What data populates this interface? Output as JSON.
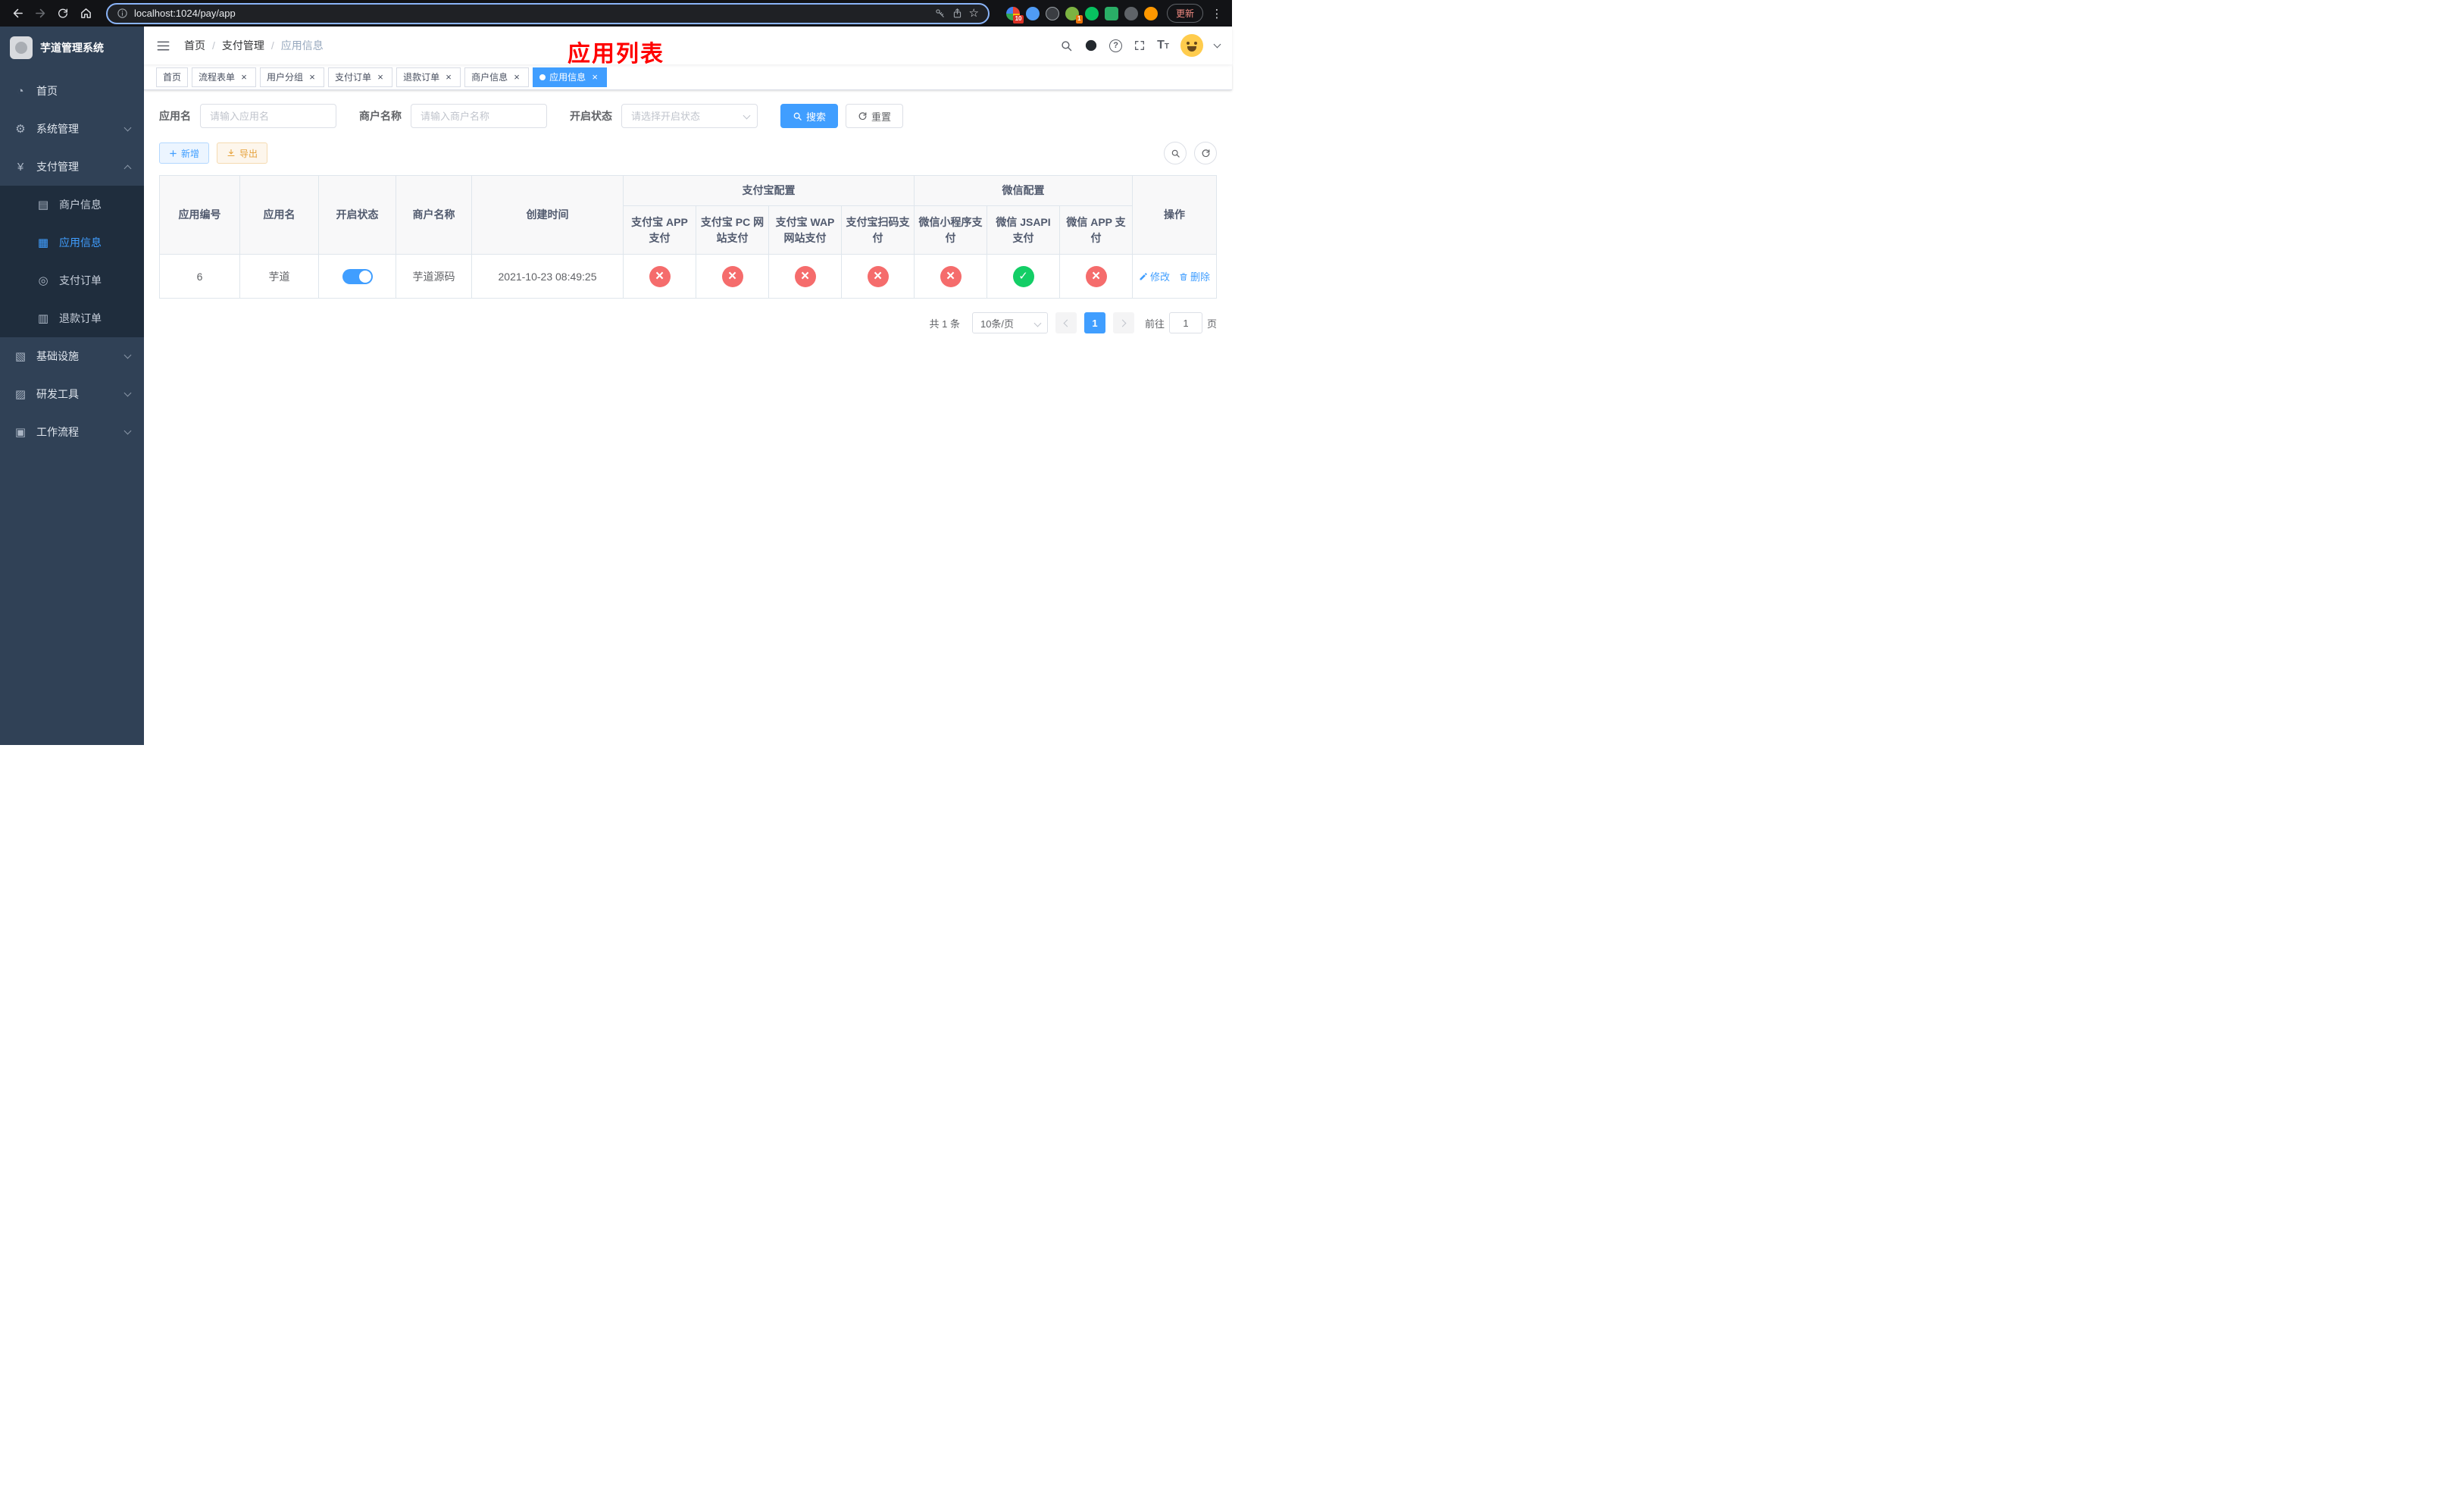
{
  "colors": {
    "accent": "#409EFF",
    "danger": "#F56C6C",
    "success": "#13CE66",
    "warning": "#E6A23C",
    "title_red": "#FF0000",
    "sidebar_bg": "#304156",
    "submenu_bg": "#1F2D3D"
  },
  "browser": {
    "url": "localhost:1024/pay/app",
    "update_label": "更新",
    "ext_badge_1": "10",
    "ext_badge_2": "1"
  },
  "sidebar": {
    "logo_title": "芋道管理系统",
    "home": "首页",
    "system": "系统管理",
    "payment": "支付管理",
    "merchant_info": "商户信息",
    "app_info": "应用信息",
    "pay_order": "支付订单",
    "refund_order": "退款订单",
    "infra": "基础设施",
    "dev_tools": "研发工具",
    "workflow": "工作流程"
  },
  "header": {
    "breadcrumb": [
      "首页",
      "支付管理",
      "应用信息"
    ],
    "page_title": "应用列表"
  },
  "tabs": [
    {
      "label": "首页"
    },
    {
      "label": "流程表单"
    },
    {
      "label": "用户分组"
    },
    {
      "label": "支付订单"
    },
    {
      "label": "退款订单"
    },
    {
      "label": "商户信息"
    },
    {
      "label": "应用信息"
    }
  ],
  "filters": {
    "app_name_label": "应用名",
    "app_name_placeholder": "请输入应用名",
    "merchant_label": "商户名称",
    "merchant_placeholder": "请输入商户名称",
    "status_label": "开启状态",
    "status_placeholder": "请选择开启状态",
    "search_label": "搜索",
    "reset_label": "重置"
  },
  "toolbar": {
    "add_label": "新增",
    "export_label": "导出"
  },
  "table": {
    "headers": {
      "app_id": "应用编号",
      "app_name": "应用名",
      "status": "开启状态",
      "merchant": "商户名称",
      "created": "创建时间",
      "alipay_group": "支付宝配置",
      "wechat_group": "微信配置",
      "alipay_app": "支付宝 APP 支付",
      "alipay_pc": "支付宝 PC 网站支付",
      "alipay_wap": "支付宝 WAP 网站支付",
      "alipay_qr": "支付宝扫码支付",
      "wx_mini": "微信小程序支付",
      "wx_jsapi": "微信 JSAPI 支付",
      "wx_app": "微信 APP 支付",
      "actions": "操作"
    },
    "row": {
      "app_id": "6",
      "app_name": "芋道",
      "status_on": true,
      "merchant": "芋道源码",
      "created": "2021-10-23 08:49:25",
      "configs": {
        "alipay_app": "fail",
        "alipay_pc": "fail",
        "alipay_wap": "fail",
        "alipay_qr": "fail",
        "wx_mini": "fail",
        "wx_jsapi": "success",
        "wx_app": "fail"
      },
      "edit_label": "修改",
      "delete_label": "删除"
    }
  },
  "pagination": {
    "total_text": "共 1 条",
    "page_size": "10条/页",
    "current_page": "1",
    "goto_label": "前往",
    "goto_value": "1",
    "page_suffix": "页"
  }
}
